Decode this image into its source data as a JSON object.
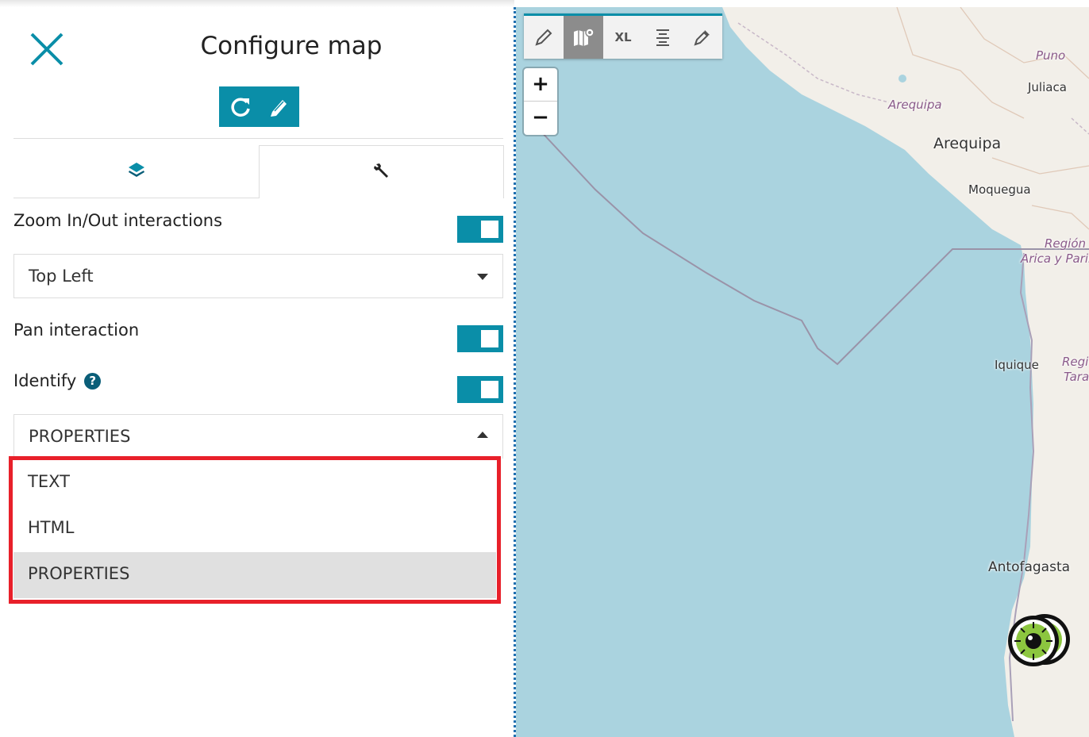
{
  "panel": {
    "title": "Configure map",
    "zoom_label": "Zoom In/Out interactions",
    "zoom_position": "Top Left",
    "pan_label": "Pan interaction",
    "identify_label": "Identify",
    "identify_help_glyph": "?",
    "identify_format": "PROPERTIES",
    "format_options": [
      "TEXT",
      "HTML",
      "PROPERTIES"
    ],
    "toggles": {
      "zoom": true,
      "pan": true,
      "identify": true
    },
    "accent_color": "#0a8ea8",
    "highlight_color": "#e8202a"
  },
  "map": {
    "toolbar": {
      "xl_label": "XL"
    },
    "zoom_in": "+",
    "zoom_out": "−",
    "labels": {
      "puno": "Puno",
      "juliaca": "Juliaca",
      "arequipa_region": "Arequipa",
      "arequipa": "Arequipa",
      "moquegua": "Moquegua",
      "region1": "Región",
      "arica": "Arica y Parir",
      "iquique": "Iquique",
      "regio2": "Regi",
      "tara": "Tara",
      "antofagasta": "Antofagasta"
    },
    "water_color": "#aad3df",
    "land_color": "#f2efe9"
  }
}
